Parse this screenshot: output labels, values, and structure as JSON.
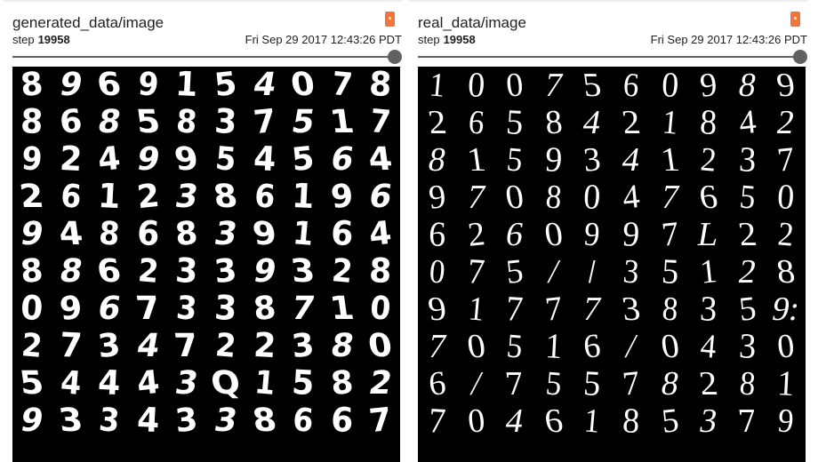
{
  "panels": [
    {
      "title": "generated_data/image",
      "step_label": "step",
      "step_value": "19958",
      "timestamp": "Fri Sep 29 2017 12:43:26 PDT",
      "digits": [
        [
          "8",
          "9",
          "6",
          "9",
          "1",
          "5",
          "4",
          "0",
          "7",
          "8"
        ],
        [
          "8",
          "6",
          "8",
          "5",
          "8",
          "3",
          "7",
          "5",
          "1",
          "7"
        ],
        [
          "9",
          "2",
          "4",
          "9",
          "9",
          "5",
          "4",
          "5",
          "6",
          "4"
        ],
        [
          "2",
          "6",
          "1",
          "2",
          "3",
          "8",
          "6",
          "1",
          "9",
          "6"
        ],
        [
          "9",
          "4",
          "8",
          "6",
          "8",
          "3",
          "9",
          "1",
          "6",
          "4"
        ],
        [
          "8",
          "8",
          "6",
          "2",
          "3",
          "3",
          "9",
          "3",
          "2",
          "8"
        ],
        [
          "0",
          "9",
          "6",
          "7",
          "3",
          "3",
          "8",
          "7",
          "1",
          "0"
        ],
        [
          "2",
          "7",
          "3",
          "4",
          "7",
          "2",
          "2",
          "3",
          "8",
          "0"
        ],
        [
          "5",
          "4",
          "4",
          "4",
          "3",
          "Q",
          "1",
          "5",
          "8",
          "2"
        ],
        [
          "9",
          "3",
          "3",
          "4",
          "3",
          "3",
          "8",
          "6",
          "6",
          "7"
        ]
      ]
    },
    {
      "title": "real_data/image",
      "step_label": "step",
      "step_value": "19958",
      "timestamp": "Fri Sep 29 2017 12:43:26 PDT",
      "digits": [
        [
          "1",
          "0",
          "0",
          "7",
          "5",
          "6",
          "0",
          "9",
          "8",
          "9"
        ],
        [
          "2",
          "6",
          "5",
          "8",
          "4",
          "2",
          "1",
          "8",
          "4",
          "2"
        ],
        [
          "8",
          "1",
          "5",
          "9",
          "3",
          "4",
          "1",
          "2",
          "3",
          "7"
        ],
        [
          "9",
          "7",
          "0",
          "8",
          "0",
          "4",
          "7",
          "6",
          "5",
          "0"
        ],
        [
          "6",
          "2",
          "6",
          "0",
          "9",
          "9",
          "7",
          "L",
          "2",
          "2"
        ],
        [
          "0",
          "7",
          "5",
          "/",
          "/",
          "3",
          "5",
          "1",
          "2",
          "8"
        ],
        [
          "9",
          "1",
          "7",
          "7",
          "7",
          "3",
          "8",
          "3",
          "5",
          "9:"
        ],
        [
          "7",
          "0",
          "5",
          "1",
          "6",
          "/",
          "0",
          "4",
          "3",
          "0"
        ],
        [
          "6",
          "/",
          "7",
          "5",
          "5",
          "7",
          "8",
          "2",
          "8",
          "1"
        ],
        [
          "7",
          "0",
          "4",
          "6",
          "1",
          "8",
          "5",
          "3",
          "7",
          "9"
        ]
      ]
    }
  ]
}
